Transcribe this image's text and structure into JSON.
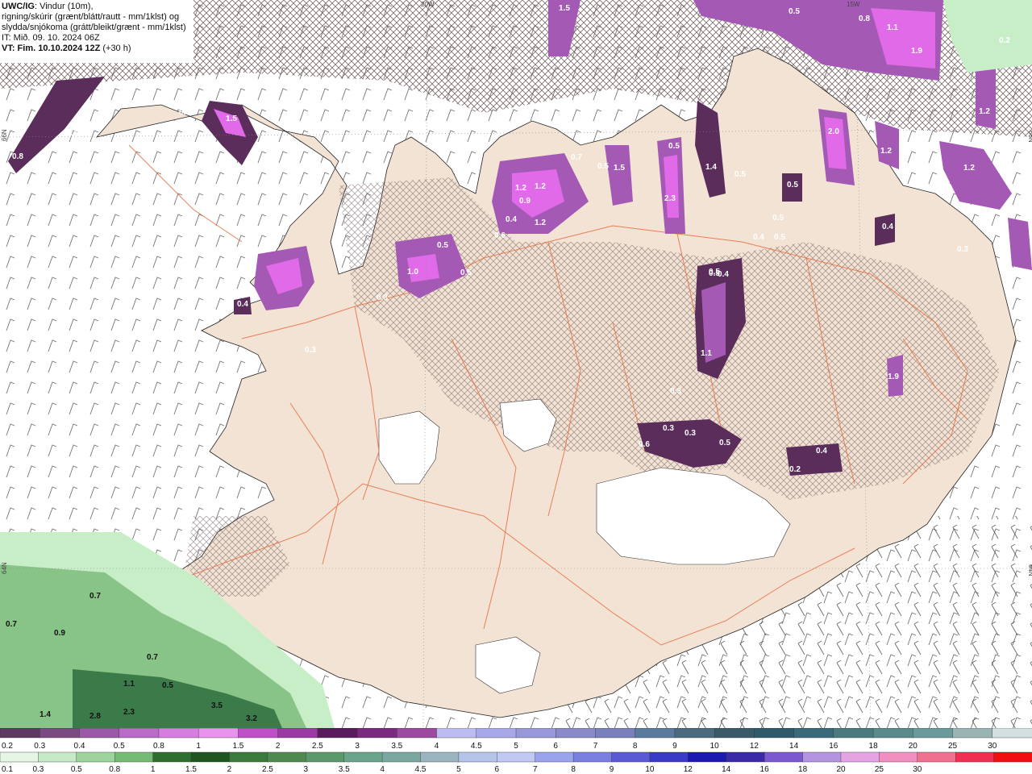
{
  "header": {
    "model": "UWC/IG",
    "line1_rest": ": Vindur (10m),",
    "line2": "rigning/skúrir (grænt/blátt/rautt - mm/1klst) og",
    "line3": "slydda/snjókoma (grátt/bleikt/grænt - mm/1klst)",
    "line4": "IT: Mið. 09. 10. 2024 06Z",
    "line5_bold": "VT: Fim. 10.10.2024 12Z",
    "line5_rest": " (+30 h)"
  },
  "grid_labels": {
    "top": [
      "20W",
      "15W"
    ],
    "left": [
      "66N",
      "64N"
    ],
    "right": [
      "66N",
      "64N"
    ]
  },
  "colors": {
    "land": "#f2e3d4",
    "sea": "#ffffff",
    "roads": "#e8744a",
    "hatch": "#6e5a5a",
    "snow_dark": "#5a2d5a",
    "snow_mid": "#a45ab4",
    "snow_bright": "#e06ae8",
    "rain_light": "#c8eec8",
    "rain_mid": "#7cbc7c",
    "rain_dark": "#2e6e3e"
  },
  "snow_labels": [
    "1.5",
    "0.4",
    "0.4",
    "0.8",
    "0.5",
    "0.8",
    "1.1",
    "1.9",
    "0.2",
    "1.2",
    "0.3",
    "1.5",
    "0.5",
    "1.5",
    "0.7",
    "0.5",
    "1.2",
    "0.9",
    "1.2",
    "0.4",
    "0.6",
    "1.2",
    "0.5",
    "1.0",
    "0.5",
    "0.3",
    "2.0",
    "1.2",
    "1.2",
    "0.5",
    "1.4",
    "0.5",
    "2.3",
    "0.5",
    "0.5",
    "0.4",
    "0.4",
    "0.5",
    "0.4",
    "0.5",
    "1.1",
    "0.3",
    "1.9",
    "0.3",
    "0.3",
    "0.3",
    "0.5",
    "0.4",
    "0.2",
    "0.6",
    "0.3"
  ],
  "rain_labels": [
    "0.7",
    "0.7",
    "0.9",
    "0.7",
    "1.1",
    "0.5",
    "3.5",
    "3.2",
    "2.8",
    "2.3",
    "1.4"
  ],
  "legend": {
    "snow_row": {
      "colors": [
        "#5e3a62",
        "#7a4a80",
        "#9a5aa8",
        "#b86cc8",
        "#d67ee0",
        "#e894ec",
        "#c050c8",
        "#9c3aa4",
        "#5a1a5e",
        "#7a2a7e",
        "#9c4aa0",
        "#bcbcf0",
        "#a8a8e8",
        "#9898d8",
        "#8a8ac8",
        "#7a80bc",
        "#5a7a9e",
        "#4a6a7e",
        "#3a5a6a",
        "#2e5a6a",
        "#3a6a7a",
        "#4a7a7e",
        "#5a8a8a",
        "#6a9a9a",
        "#9ab4b4",
        "#d4e0e0"
      ],
      "labels": [
        "0.2",
        "0.3",
        "0.4",
        "0.5",
        "0.8",
        "1",
        "1.5",
        "2",
        "2.5",
        "3",
        "3.5",
        "4",
        "4.5",
        "5",
        "6",
        "7",
        "8",
        "9",
        "10",
        "12",
        "14",
        "16",
        "18",
        "20",
        "25",
        "30"
      ]
    },
    "rain_row": {
      "colors": [
        "#e4f6e4",
        "#c6eac6",
        "#9cd49c",
        "#74bc74",
        "#2e6e2e",
        "#1e561e",
        "#3a7a3a",
        "#4e8a4e",
        "#5a9a6a",
        "#6aa48a",
        "#7aa8a0",
        "#9ab4c0",
        "#b4c4e8",
        "#c0c8f4",
        "#9aa4ec",
        "#7a80e0",
        "#5a5ad4",
        "#3a3ac8",
        "#1a1ab0",
        "#3a2aa8",
        "#7a5acc",
        "#b494e0",
        "#e4a4e4",
        "#f090c0",
        "#f07090",
        "#f03050",
        "#f01010"
      ],
      "labels": [
        "0.1",
        "0.3",
        "0.5",
        "0.8",
        "1",
        "1.5",
        "2",
        "2.5",
        "3",
        "3.5",
        "4",
        "4.5",
        "5",
        "6",
        "7",
        "8",
        "9",
        "10",
        "12",
        "14",
        "16",
        "18",
        "20",
        "25",
        "30"
      ]
    }
  }
}
